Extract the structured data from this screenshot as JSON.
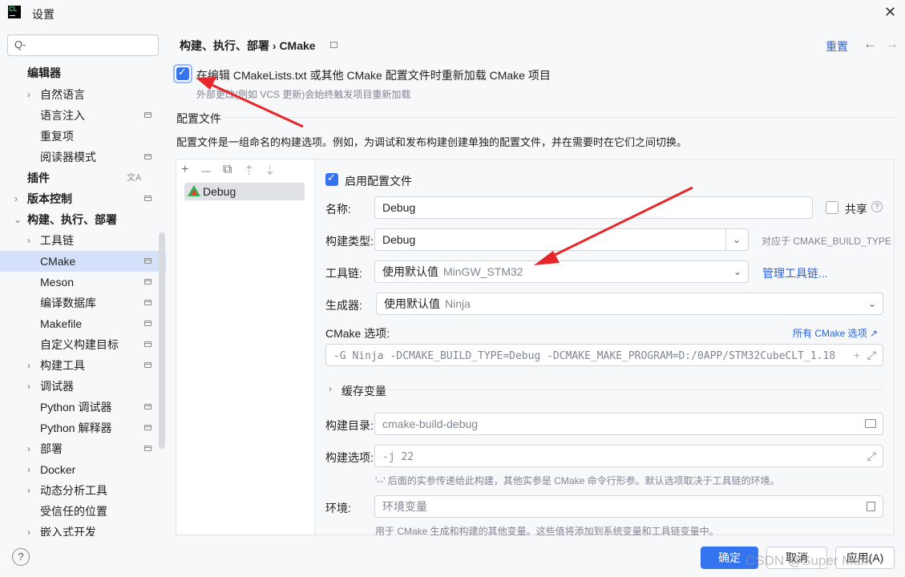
{
  "window": {
    "app_logo": "CL",
    "title": "设置",
    "close_glyph": "✕"
  },
  "search": {
    "glyph": "Q-"
  },
  "sidebar": {
    "items": [
      {
        "label": "编辑器"
      },
      {
        "label": "自然语言"
      },
      {
        "label": "语言注入"
      },
      {
        "label": "重复项"
      },
      {
        "label": "阅读器模式"
      },
      {
        "label": "插件"
      },
      {
        "label": "版本控制"
      },
      {
        "label": "构建、执行、部署"
      },
      {
        "label": "工具链"
      },
      {
        "label": "CMake"
      },
      {
        "label": "Meson"
      },
      {
        "label": "编译数据库"
      },
      {
        "label": "Makefile"
      },
      {
        "label": "自定义构建目标"
      },
      {
        "label": "构建工具"
      },
      {
        "label": "调试器"
      },
      {
        "label": "Python 调试器"
      },
      {
        "label": "Python 解释器"
      },
      {
        "label": "部署"
      },
      {
        "label": "Docker"
      },
      {
        "label": "动态分析工具"
      },
      {
        "label": "受信任的位置"
      },
      {
        "label": "嵌入式开发"
      }
    ],
    "plugins_badge": "文A",
    "help": "?"
  },
  "header": {
    "breadcrumb": "构建、执行、部署  ›  CMake",
    "reset": "重置",
    "back": "←",
    "forward": "→"
  },
  "reload": {
    "label": "在编辑 CMakeLists.txt 或其他 CMake 配置文件时重新加载 CMake 项目",
    "hint": "外部更改(例如 VCS 更新)会始终触发项目重新加载"
  },
  "profiles": {
    "title": "配置文件",
    "description": "配置文件是一组命名的构建选项。例如，为调试和发布构建创建单独的配置文件，并在需要时在它们之间切换。",
    "toolbar": {
      "add": "+",
      "remove": "—",
      "copy": "⧉",
      "up": "⇡",
      "down": "⇣"
    },
    "items": [
      "Debug"
    ]
  },
  "detail": {
    "enable_label": "启用配置文件",
    "name_label": "名称:",
    "name_value": "Debug",
    "share_label": "共享",
    "help_glyph": "?",
    "build_type_label": "构建类型:",
    "build_type_value": "Debug",
    "build_type_hint": "对应于 CMAKE_BUILD_TYPE",
    "toolchain_label": "工具链:",
    "toolchain_value": "使用默认值",
    "toolchain_hint": "MinGW_STM32",
    "manage_toolchains": "管理工具链...",
    "generator_label": "生成器:",
    "generator_value": "使用默认值",
    "generator_hint": "Ninja",
    "cmake_options_label": "CMake 选项:",
    "all_cmake_options": "所有 CMake 选项 ↗",
    "cmake_options_value": "-G Ninja -DCMAKE_BUILD_TYPE=Debug -DCMAKE_MAKE_PROGRAM=D:/0APP/STM32CubeCLT_1.18",
    "cache_vars": "缓存变量",
    "build_dir_label": "构建目录:",
    "build_dir_value": "cmake-build-debug",
    "build_options_label": "构建选项:",
    "build_options_value": "-j 22",
    "build_options_hint": "'--' 后面的实参传递给此构建，其他实参是 CMake 命令行形参。默认选项取决于工具链的环境。",
    "env_label": "环境:",
    "env_placeholder": "环境变量",
    "env_hint": "用于 CMake 生成和构建的其他变量。这些值将添加到系统变量和工具链变量中。"
  },
  "footer": {
    "ok": "确定",
    "cancel": "取消",
    "apply": "应用(A)"
  },
  "watermark": "CSDN @Super Mark",
  "colors": {
    "accent": "#3574f0",
    "selection": "#d5e1fb",
    "annotation_arrow": "#e8262a",
    "link": "#2c62d8"
  }
}
